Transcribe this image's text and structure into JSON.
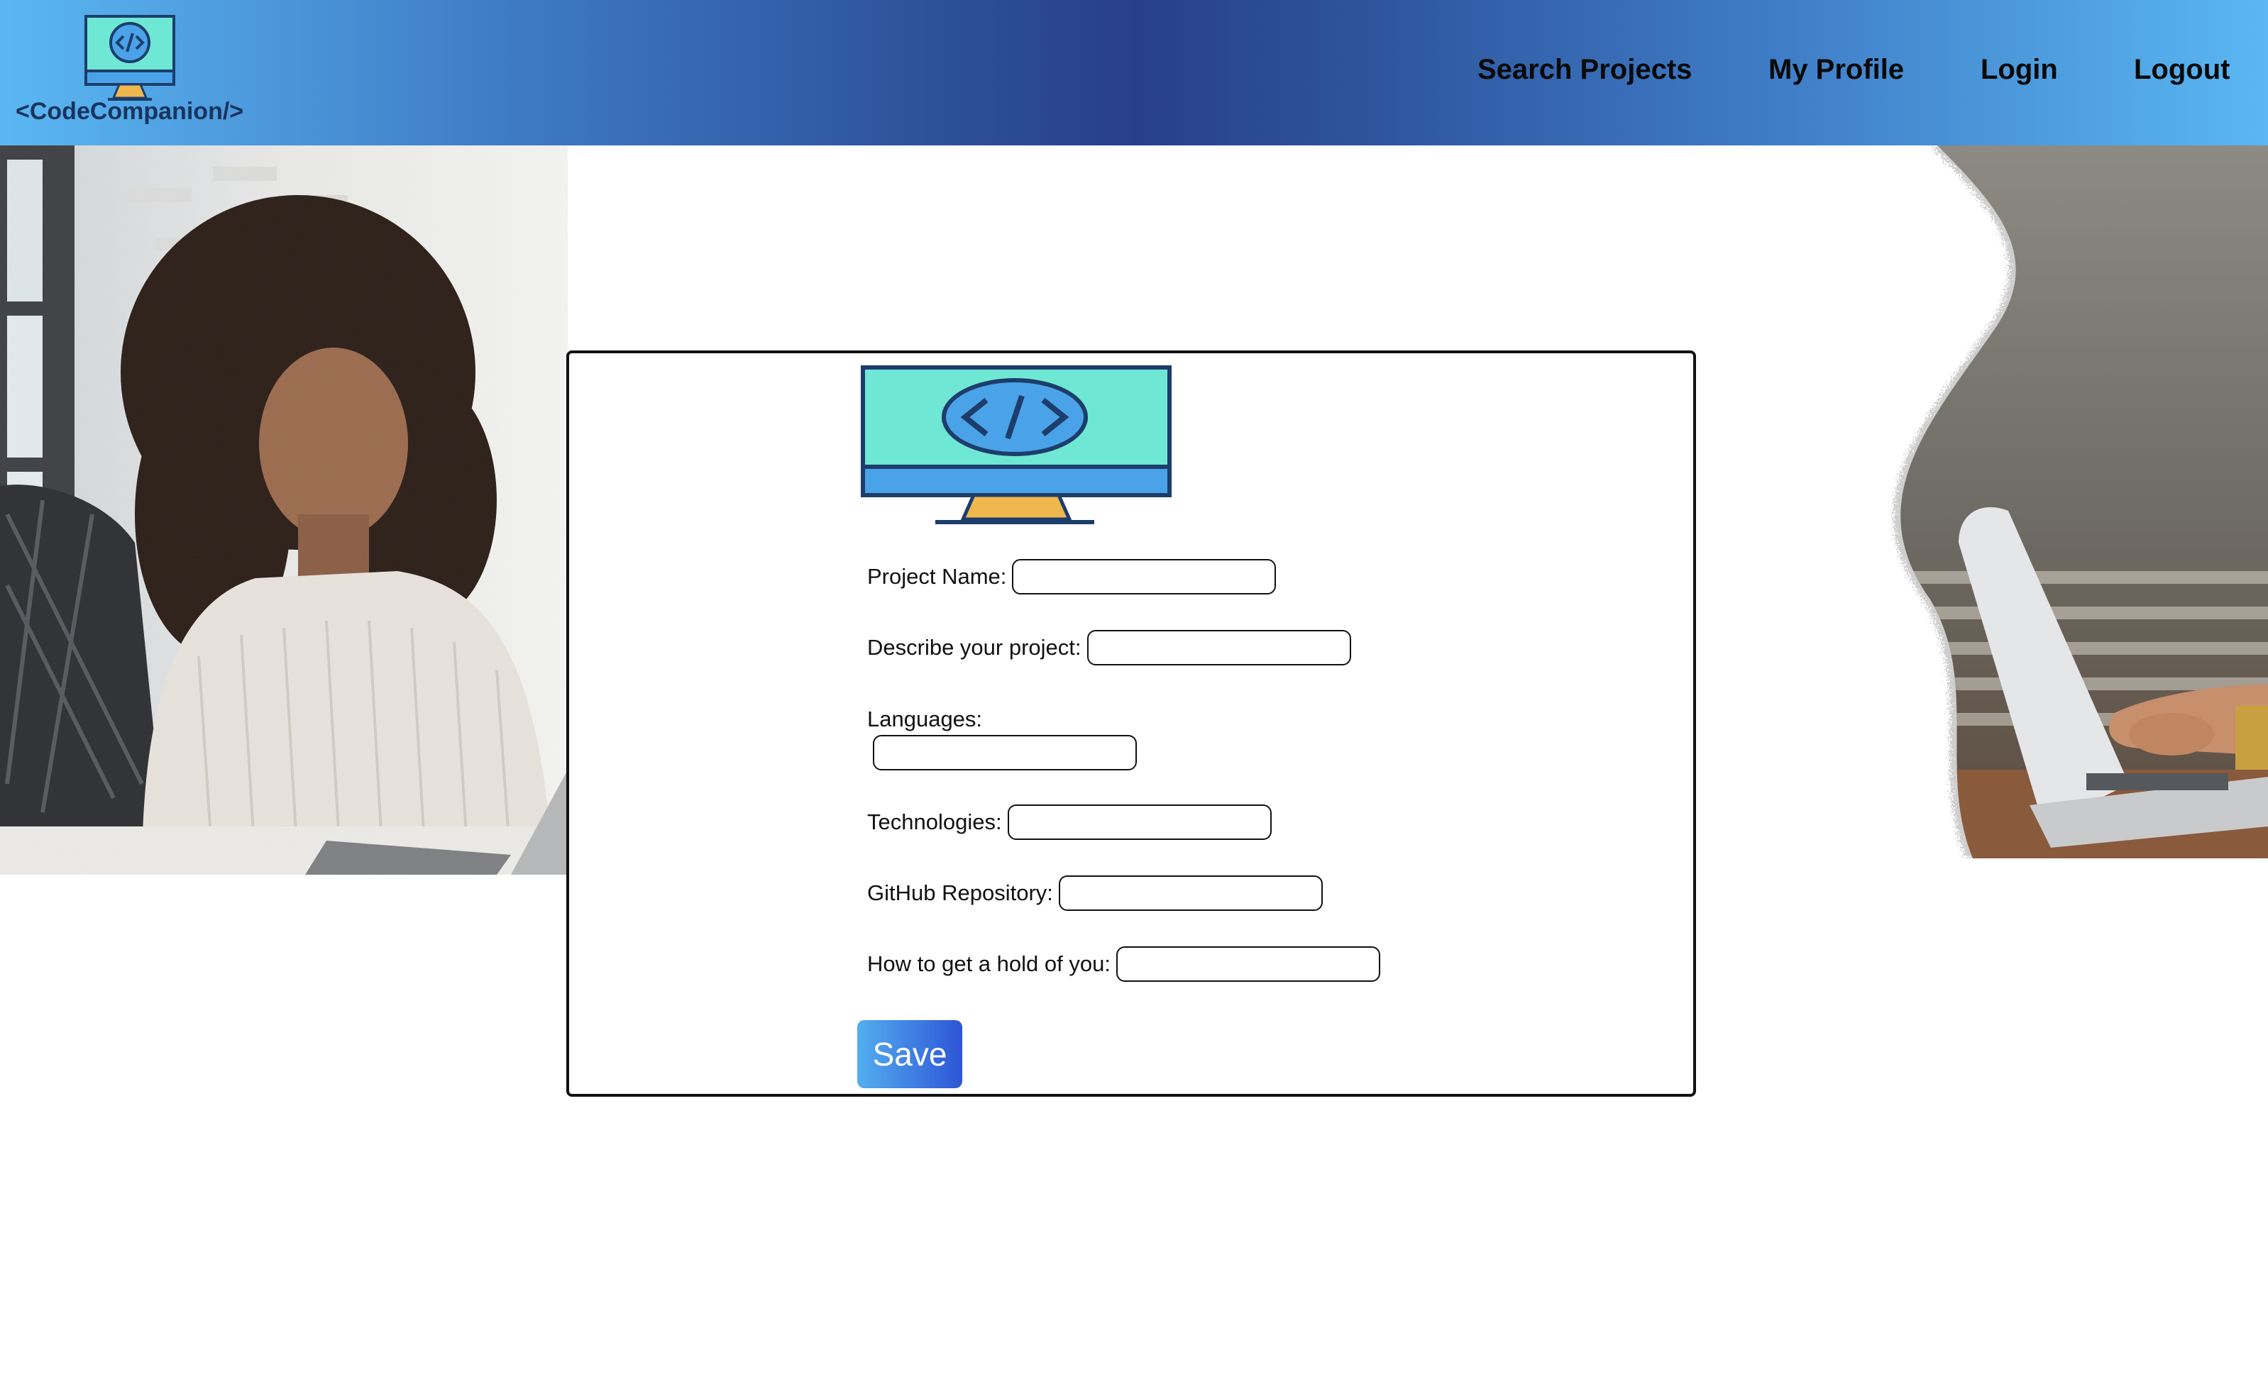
{
  "header": {
    "brand": "<CodeCompanion/>",
    "nav": [
      {
        "label": "Search Projects"
      },
      {
        "label": "My Profile"
      },
      {
        "label": "Login"
      },
      {
        "label": "Logout"
      }
    ]
  },
  "form": {
    "fields": [
      {
        "label": "Project Name:",
        "value": ""
      },
      {
        "label": "Describe your project:",
        "value": ""
      },
      {
        "label": "Languages:",
        "value": ""
      },
      {
        "label": "Technologies:",
        "value": ""
      },
      {
        "label": "GitHub Repository:",
        "value": ""
      },
      {
        "label": "How to get a hold of you:",
        "value": ""
      }
    ],
    "save_label": "Save"
  },
  "icons": {
    "logo": "code-monitor-icon",
    "card_illustration": "code-monitor-icon"
  },
  "colors": {
    "header_gradient_edge": "#5ab7f2",
    "header_gradient_center": "#283f8d",
    "brand_text": "#17345e",
    "monitor_screen": "#6ee7d4",
    "monitor_frame": "#1d3d6b",
    "monitor_code_badge": "#4aa3e8",
    "monitor_stand": "#efb84f",
    "save_gradient_start": "#54aef0",
    "save_gradient_end": "#2d55d6"
  }
}
